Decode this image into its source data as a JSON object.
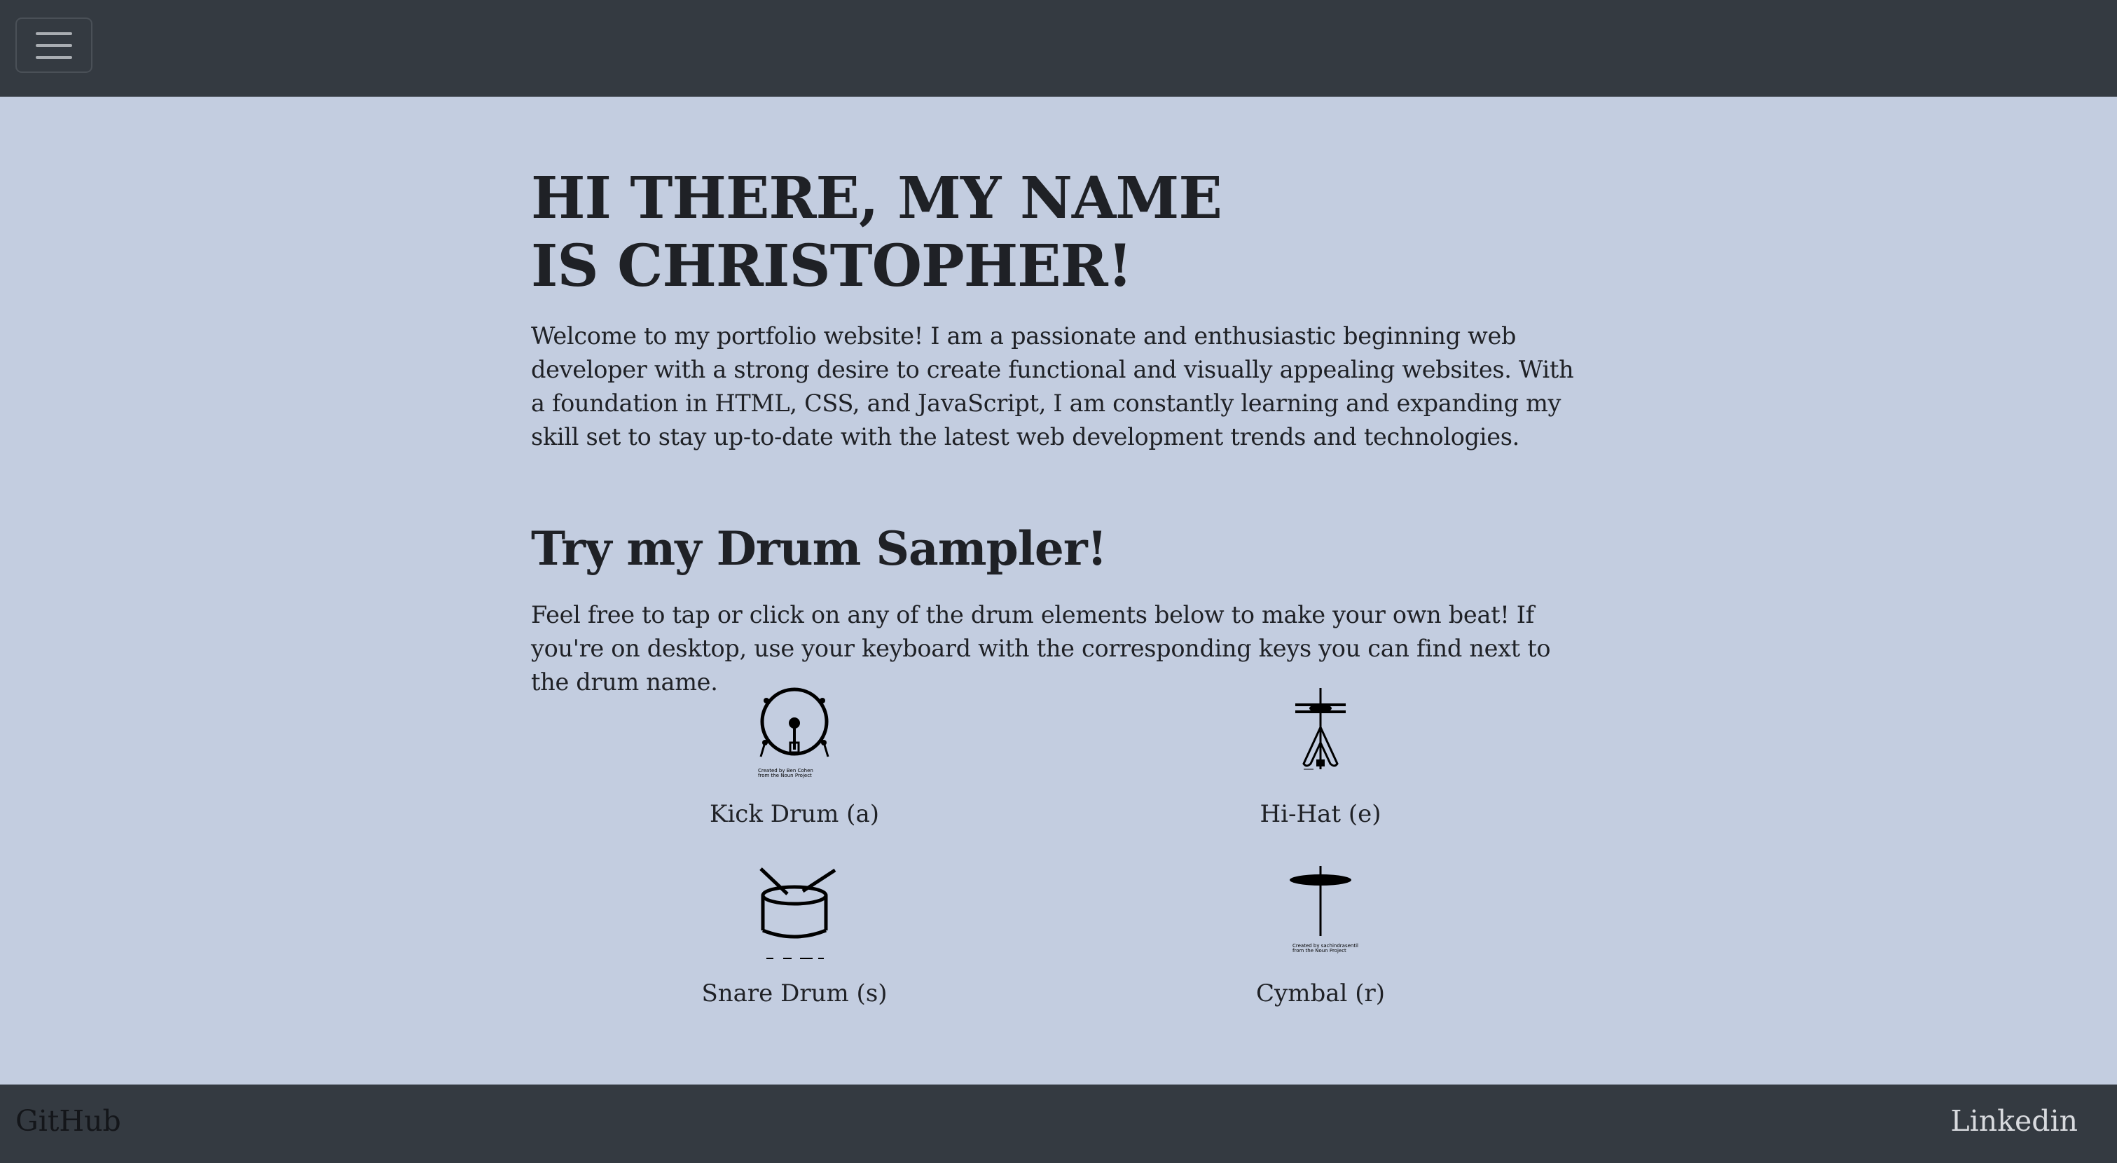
{
  "navbar": {
    "toggle_icon": "hamburger-menu-icon"
  },
  "hero": {
    "title": "HI THERE, MY NAME IS CHRISTOPHER!",
    "intro": "Welcome to my portfolio website! I am a passionate and enthusiastic beginning web developer with a strong desire to create functional and visually appealing websites. With a foundation in HTML, CSS, and JavaScript, I am constantly learning and expanding my skill set to stay up-to-date with the latest web development trends and technologies."
  },
  "sampler": {
    "title": "Try my Drum Sampler!",
    "description": "Feel free to tap or click on any of the drum elements below to make your own beat! If you're on desktop, use your keyboard with the corresponding keys you can find next to the drum name.",
    "drums": [
      {
        "label": "Kick Drum (a)",
        "icon": "kick-drum-icon",
        "credit": "Created by Ben Cohen from the Noun Project"
      },
      {
        "label": "Hi-Hat (e)",
        "icon": "hi-hat-icon"
      },
      {
        "label": "Snare Drum (s)",
        "icon": "snare-drum-icon"
      },
      {
        "label": "Cymbal (r)",
        "icon": "cymbal-icon",
        "credit": "Created by sachindrasentil from the Noun Project"
      }
    ]
  },
  "footer": {
    "github": "GitHub",
    "linkedin": "Linkedin"
  },
  "colors": {
    "navbar_bg": "#343a41",
    "page_bg": "#c3cde0",
    "text": "#1f2126"
  }
}
